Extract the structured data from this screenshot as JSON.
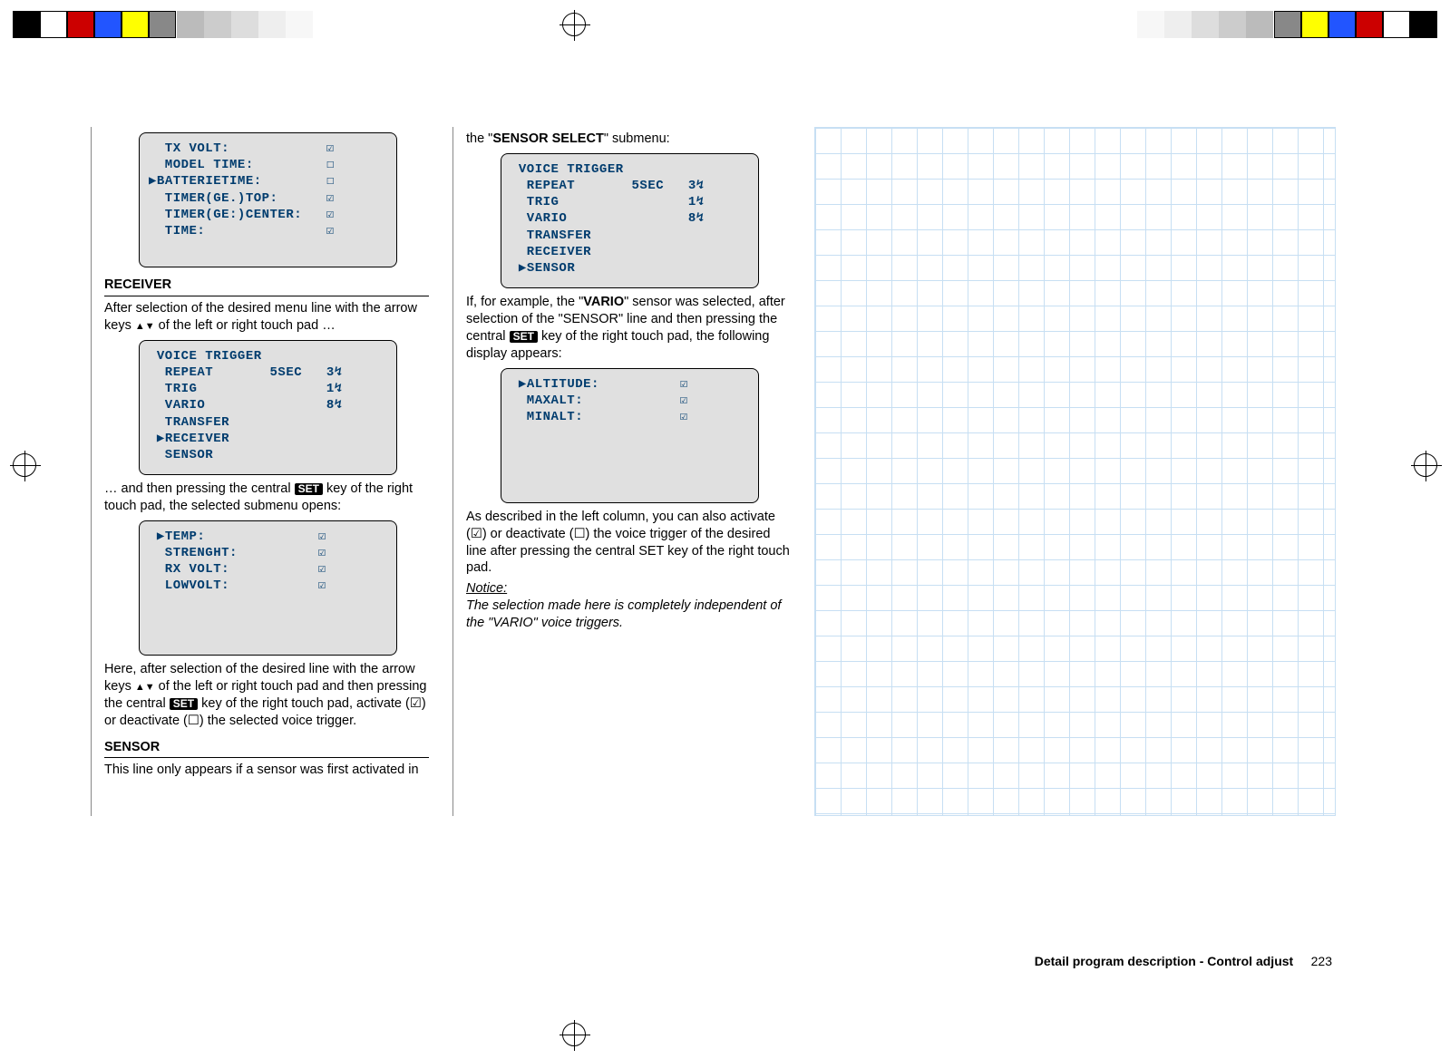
{
  "lcd1": "  TX VOLT:            ☑\n  MODEL TIME:         ☐\n▶BATTERIETIME:        ☐\n  TIMER(GE.)TOP:      ☑\n  TIMER(GE:)CENTER:   ☑\n  TIME:               ☑\n\n",
  "section_receiver": "RECEIVER",
  "para_receiver_1_a": "After selection of the desired menu line with the arrow keys ",
  "para_receiver_1_b": " of the left or right touch pad …",
  "lcd2": " VOICE TRIGGER\n  REPEAT       5SEC   3↯\n  TRIG                1↯\n  VARIO               8↯\n  TRANSFER\n ▶RECEIVER\n  SENSOR\n",
  "para_receiver_2_a": "… and then pressing the central ",
  "para_receiver_2_b": " key of the right touch pad, the selected submenu opens:",
  "lcd3": " ▶TEMP:              ☑\n  STRENGHT:          ☑\n  RX VOLT:           ☑\n  LOWVOLT:           ☑\n\n\n\n",
  "para_receiver_3_a": "Here, after selection of the desired line with the arrow keys ",
  "para_receiver_3_b": " of the left or right touch pad and then pressing the central ",
  "para_receiver_3_c": " key of the right touch pad, activate (☑) or deactivate (☐) the selected voice trigger.",
  "section_sensor": "SENSOR",
  "para_sensor_1": "This line only appears if a sensor was first activated in",
  "col2_intro_a": "the \"",
  "col2_intro_bold": "SENSOR SELECT",
  "col2_intro_b": "\" submenu:",
  "lcd4": " VOICE TRIGGER\n  REPEAT       5SEC   3↯\n  TRIG                1↯\n  VARIO               8↯\n  TRANSFER\n  RECEIVER\n ▶SENSOR\n",
  "para_col2_1_a": "If, for example, the \"",
  "para_col2_1_bold": "VARIO",
  "para_col2_1_b": "\" sensor was selected, after selection of the \"SENSOR\" line and then pressing the central ",
  "para_col2_1_c": " key of the right touch pad, the following display appears:",
  "lcd5": " ▶ALTITUDE:          ☑\n  MAXALT:            ☑\n  MINALT:            ☑\n\n\n\n\n",
  "para_col2_2": "As described in the left column, you can also activate (☑) or deactivate (☐) the voice trigger of the desired line after pressing the central SET key of the right touch pad.",
  "notice_label": "Notice:",
  "notice_text": "The selection made here is completely independent of the \"VARIO\" voice triggers.",
  "set_label": "SET",
  "arrows_updown": "▲▼",
  "footer_text": "Detail program description - Control adjust",
  "footer_page": "223"
}
